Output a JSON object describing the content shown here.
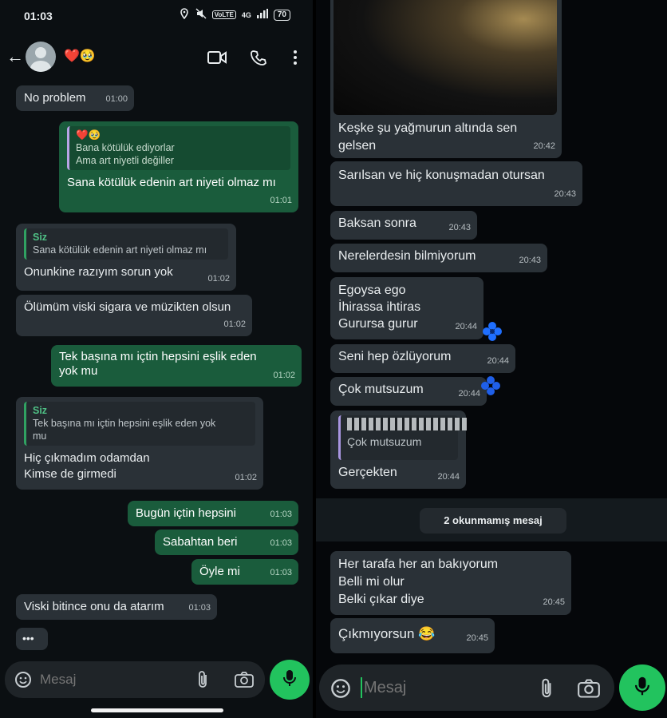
{
  "status": {
    "time": "01:03",
    "network": "4G",
    "battery": "70"
  },
  "chat": {
    "contact_name": "❤️🥹"
  },
  "left_messages": [
    {
      "text": "No problem",
      "time": "01:00"
    },
    {
      "quote_name": "❤️🥹",
      "quote_lines": [
        "Bana kötülük ediyorlar",
        "Ama art niyetli değiller"
      ],
      "text": "Sana kötülük edenin art niyeti olmaz mı",
      "time": "01:01"
    },
    {
      "quote_name": "Siz",
      "quote_lines": [
        "Sana kötülük edenin art niyeti olmaz mı"
      ],
      "text": "Onunkine razıyım sorun yok",
      "time": "01:02"
    },
    {
      "text": "Ölümüm viski sigara ve müzikten olsun",
      "time": "01:02"
    },
    {
      "text_lines": [
        "Tek başına mı içtin hepsini eşlik eden",
        "yok mu"
      ],
      "time": "01:02"
    },
    {
      "quote_name": "Siz",
      "quote_lines": [
        "Tek başına mı içtin hepsini eşlik eden yok",
        "mu"
      ],
      "text_lines": [
        "Hiç çıkmadım odamdan",
        "Kimse de girmedi"
      ],
      "time": "01:02"
    },
    {
      "text": "Bugün içtin hepsini",
      "time": "01:03"
    },
    {
      "text": "Sabahtan beri",
      "time": "01:03"
    },
    {
      "text": "Öyle mi",
      "time": "01:03"
    },
    {
      "text": "Viski bitince onu da atarım",
      "time": "01:03"
    },
    {
      "text": "•••"
    }
  ],
  "right_messages": [
    {
      "text_lines": [
        "Keşke şu yağmurun altında sen",
        "gelsen"
      ],
      "time": "20:42"
    },
    {
      "text": "Sarılsan ve hiç konuşmadan otursan",
      "time": "20:43"
    },
    {
      "text": "Baksan sonra",
      "time": "20:43"
    },
    {
      "text": "Nerelerdesin bilmiyorum",
      "time": "20:43"
    },
    {
      "text_lines": [
        "Egoysa ego",
        "İhirassa ihtiras",
        "Gurursa gurur"
      ],
      "time": "20:44"
    },
    {
      "text": "Seni hep özlüyorum",
      "time": "20:44"
    },
    {
      "text": "Çok mutsuzum",
      "time": "20:44"
    },
    {
      "quote_text": "Çok mutsuzum",
      "text": "Gerçekten",
      "time": "20:44"
    },
    {
      "text_lines": [
        "Her tarafa her an bakıyorum",
        "Belli mi olur",
        "Belki çıkar diye"
      ],
      "time": "20:45"
    },
    {
      "text": "Çıkmıyorsun 😂",
      "time": "20:45"
    }
  ],
  "unread_label": "2 okunmamış mesaj",
  "input": {
    "placeholder": "Mesaj"
  },
  "colors": {
    "incoming": "#2a3137",
    "outgoing": "#1a5c3c",
    "accent": "#22c35e"
  }
}
